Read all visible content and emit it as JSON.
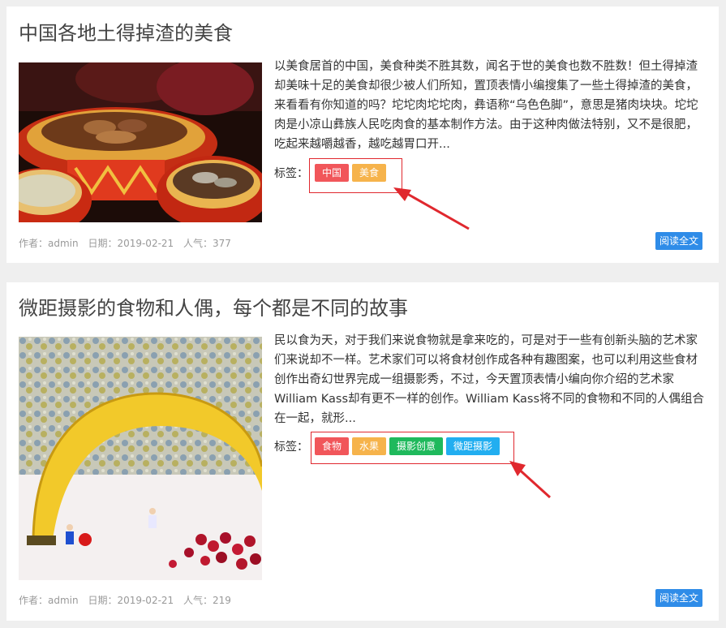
{
  "articles": [
    {
      "title": "中国各地土得掉渣的美食",
      "excerpt": "以美食居首的中国，美食种类不胜其数，闻名于世的美食也数不胜数！但土得掉渣却美味十足的美食却很少被人们所知，置顶表情小编搜集了一些土得掉渣的美食，来看看有你知道的吗？坨坨肉坨坨肉，彝语称“乌色色脚”，意思是猪肉块块。坨坨肉是小凉山彝族人民吃肉食的基本制作方法。由于这种肉做法特别，又不是很肥，吃起来越嚼越香，越吃越胃口开...",
      "tags_label": "标签：",
      "tags": [
        {
          "label": "中国",
          "color": "#f1565a"
        },
        {
          "label": "美食",
          "color": "#f6b34b"
        }
      ],
      "meta": {
        "author": "作者：admin",
        "date": "日期：2019-02-21",
        "views": "人气：377"
      },
      "read_more": "阅读全文",
      "image_icon": "food-photo"
    },
    {
      "title": "微距摄影的食物和人偶，每个都是不同的故事",
      "excerpt": "民以食为天，对于我们来说食物就是拿来吃的，可是对于一些有创新头脑的艺术家们来说却不一样。艺术家们可以将食材创作成各种有趣图案，也可以利用这些食材创作出奇幻世界完成一组摄影秀，不过，今天置顶表情小编向你介绍的艺术家William Kass却有更不一样的创作。William Kass将不同的食物和不同的人偶组合在一起，就形...",
      "tags_label": "标签：",
      "tags": [
        {
          "label": "食物",
          "color": "#f1565a"
        },
        {
          "label": "水果",
          "color": "#f6b34b"
        },
        {
          "label": "摄影创意",
          "color": "#1fb95c"
        },
        {
          "label": "微距摄影",
          "color": "#22aef0"
        }
      ],
      "meta": {
        "author": "作者：admin",
        "date": "日期：2019-02-21",
        "views": "人气：219"
      },
      "read_more": "阅读全文",
      "image_icon": "banana-photo"
    }
  ],
  "colors": {
    "highlight": "#e0282e",
    "button": "#2f8ce8",
    "background": "#efefef"
  }
}
